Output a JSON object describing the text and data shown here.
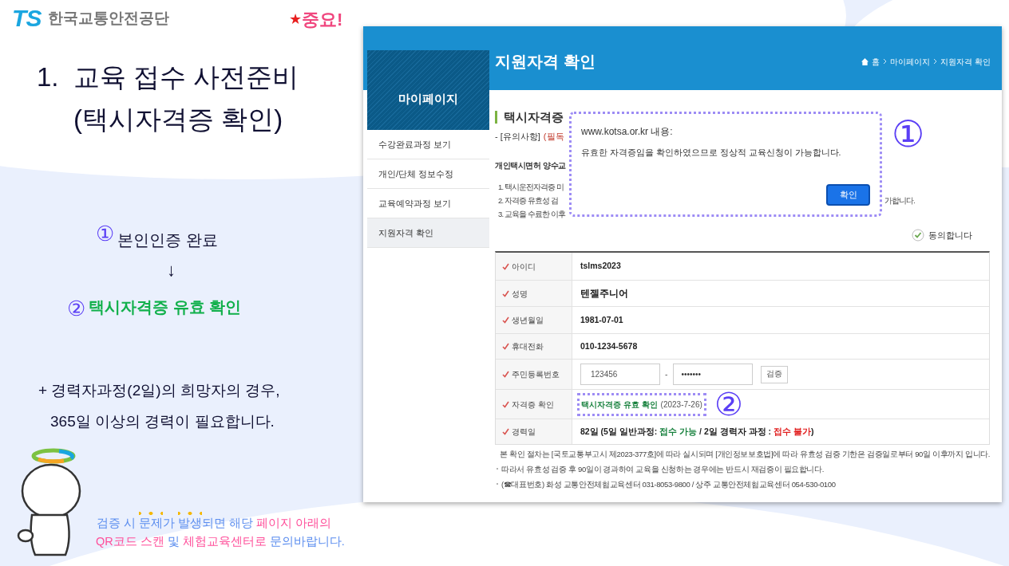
{
  "slide": {
    "logo": {
      "mark": "TS",
      "org": "한국교통안전공단"
    },
    "badge": {
      "star": "★",
      "text": "중요!"
    },
    "title_lines": [
      "1.  교육 접수 사전준비",
      "(택시자격증 확인)"
    ],
    "steps": [
      {
        "number": "①",
        "text": "본인인증 완료",
        "highlighted": false
      },
      {
        "number": "②",
        "text": "택시자격증 유효 확인",
        "highlighted": true
      }
    ],
    "arrow": "↓",
    "note_lines": [
      "+ 경력자과정(2일)의 희망자의 경우,",
      "365일 이상의 경력이 필요합니다."
    ],
    "help_lines": [
      [
        {
          "text": "검증 시 ",
          "color": "#5b8def",
          "emphasis": false
        },
        {
          "text": "문제",
          "color": "#5b8def",
          "emphasis": true
        },
        {
          "text": "가 ",
          "color": "#5b8def",
          "emphasis": false
        },
        {
          "text": "발생",
          "color": "#5b8def",
          "emphasis": true
        },
        {
          "text": "되면 해당 ",
          "color": "#5b8def",
          "emphasis": false
        },
        {
          "text": "페이지 아래의",
          "color": "#ff4f9a",
          "emphasis": false
        }
      ],
      [
        {
          "text": "QR코드 스캔",
          "color": "#ff4f9a",
          "emphasis": false
        },
        {
          "text": " 및 ",
          "color": "#5b8def",
          "emphasis": false
        },
        {
          "text": "체험교육센터로",
          "color": "#ff4f9a",
          "emphasis": false
        },
        {
          "text": " 문의바랍니다.",
          "color": "#5b8def",
          "emphasis": false
        }
      ]
    ]
  },
  "screen": {
    "page_title": "지원자격 확인",
    "breadcrumb": [
      "홈",
      "마이페이지",
      "지원자격 확인"
    ],
    "sidebar": {
      "title": "마이페이지",
      "items": [
        {
          "label": "수강완료과정 보기",
          "selected": false
        },
        {
          "label": "개인/단체 정보수정",
          "selected": false
        },
        {
          "label": "교육예약과정 보기",
          "selected": false
        },
        {
          "label": "지원자격 확인",
          "selected": true
        }
      ]
    },
    "section_title": "택시자격증 ",
    "notice": {
      "label": "- [유의사항]",
      "note": "(필독"
    },
    "notice_heading": "개인택시면허 양수교",
    "numbered_lines": [
      {
        "text": "1. 택시운전자격증 미"
      },
      {
        "text": "2. 자격증 유효성 검",
        "tail": "가합니다."
      },
      {
        "text": "3. 교육을 수료한 이후"
      }
    ],
    "agree": {
      "label": "동의합니다",
      "checked": true
    },
    "rows": [
      {
        "label": "아이디",
        "kind": "text",
        "value": "tslms2023"
      },
      {
        "label": "성명",
        "kind": "name",
        "value": "텐젤주니어"
      },
      {
        "label": "생년월일",
        "kind": "text",
        "value": "1981-07-01"
      },
      {
        "label": "휴대전화",
        "kind": "text",
        "value": "010-1234-5678"
      },
      {
        "label": "주민등록번호",
        "kind": "ssn",
        "first": "123456",
        "separator": "-",
        "second": "•••••••",
        "button": "검증"
      },
      {
        "label": "자격증 확인",
        "kind": "status",
        "status": "택시자격증 유효 확인",
        "date": "(2023-7-26)"
      },
      {
        "label": "경력일",
        "kind": "segments",
        "segments": [
          {
            "text": "82일 (5일 일반과정: ",
            "color": "#222222"
          },
          {
            "text": "접수 가능",
            "color": "#16803c"
          },
          {
            "text": " / 2일 경력자 과정 : ",
            "color": "#222222"
          },
          {
            "text": "접수 불가",
            "color": "#e11d1d"
          },
          {
            "text": ")",
            "color": "#222222"
          }
        ]
      }
    ],
    "notes": [
      "본 확인 절차는 [국토교통부고시 제2023-377호]에 따라 실시되며 [개인정보보호법]에 따라 유효성 검증 기한은 검증일로부터 90일 이후까지 입니다.",
      "따라서 유효성 검증 후 90일이 경과하여 교육을 신청하는 경우에는 반드시 재검증이 필요합니다.",
      "(☎대표번호) 화성 교통안전체험교육센터 031-8053-9800 / 상주 교통안전체험교육센터 054-530-0100"
    ],
    "dialog": {
      "origin": "www.kotsa.or.kr 내용:",
      "message": "유효한 자격증임을 확인하였으므로 정상적 교육신청이 가능합니다.",
      "button": "확인"
    },
    "annotations": [
      "①",
      "②"
    ]
  }
}
